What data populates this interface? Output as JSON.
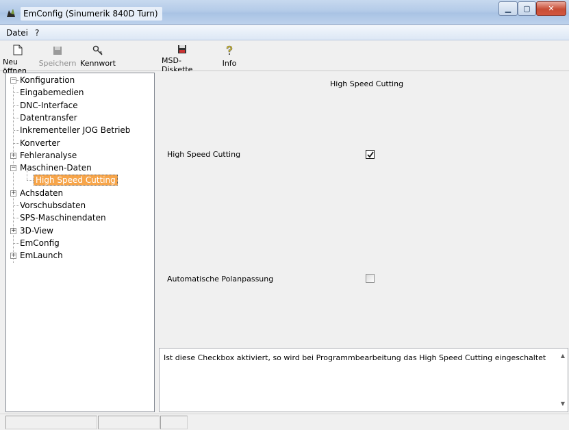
{
  "window": {
    "title": "EmConfig (Sinumerik 840D Turn)"
  },
  "menu": {
    "items": [
      "Datei",
      "?"
    ]
  },
  "toolbar": {
    "buttons": [
      {
        "label": "Neu öffnen",
        "icon": "document-icon",
        "enabled": true
      },
      {
        "label": "Speichern",
        "icon": "save-icon",
        "enabled": false
      },
      {
        "label": "Kennwort",
        "icon": "key-icon",
        "enabled": true
      },
      {
        "label": "MSD-Diskette",
        "icon": "diskette-icon",
        "enabled": true
      },
      {
        "label": "Info",
        "icon": "info-icon",
        "enabled": true
      }
    ]
  },
  "tree": {
    "root": "Konfiguration",
    "nodes": [
      {
        "label": "Eingabemedien"
      },
      {
        "label": "DNC-Interface"
      },
      {
        "label": "Datentransfer"
      },
      {
        "label": "Inkrementeller JOG Betrieb"
      },
      {
        "label": "Konverter"
      },
      {
        "label": "Fehleranalyse",
        "expander": "+"
      },
      {
        "label": "Maschinen-Daten",
        "expander": "-"
      },
      {
        "label": "High Speed Cutting",
        "selected": true
      },
      {
        "label": "Achsdaten",
        "expander": "+"
      },
      {
        "label": "Vorschubsdaten"
      },
      {
        "label": "SPS-Maschinendaten"
      },
      {
        "label": "3D-View",
        "expander": "+"
      },
      {
        "label": "EmConfig"
      },
      {
        "label": "EmLaunch",
        "expander": "+"
      }
    ]
  },
  "panel": {
    "title": "High Speed Cutting",
    "options": [
      {
        "label": "High Speed Cutting",
        "checked": true
      },
      {
        "label": "Automatische Polanpassung",
        "checked": false
      }
    ],
    "description": "Ist diese Checkbox aktiviert, so wird bei Programmbearbeitung das High Speed Cutting eingeschaltet"
  },
  "colors": {
    "selection": "#f7a54a",
    "titlebar": "#b4cbe8"
  }
}
